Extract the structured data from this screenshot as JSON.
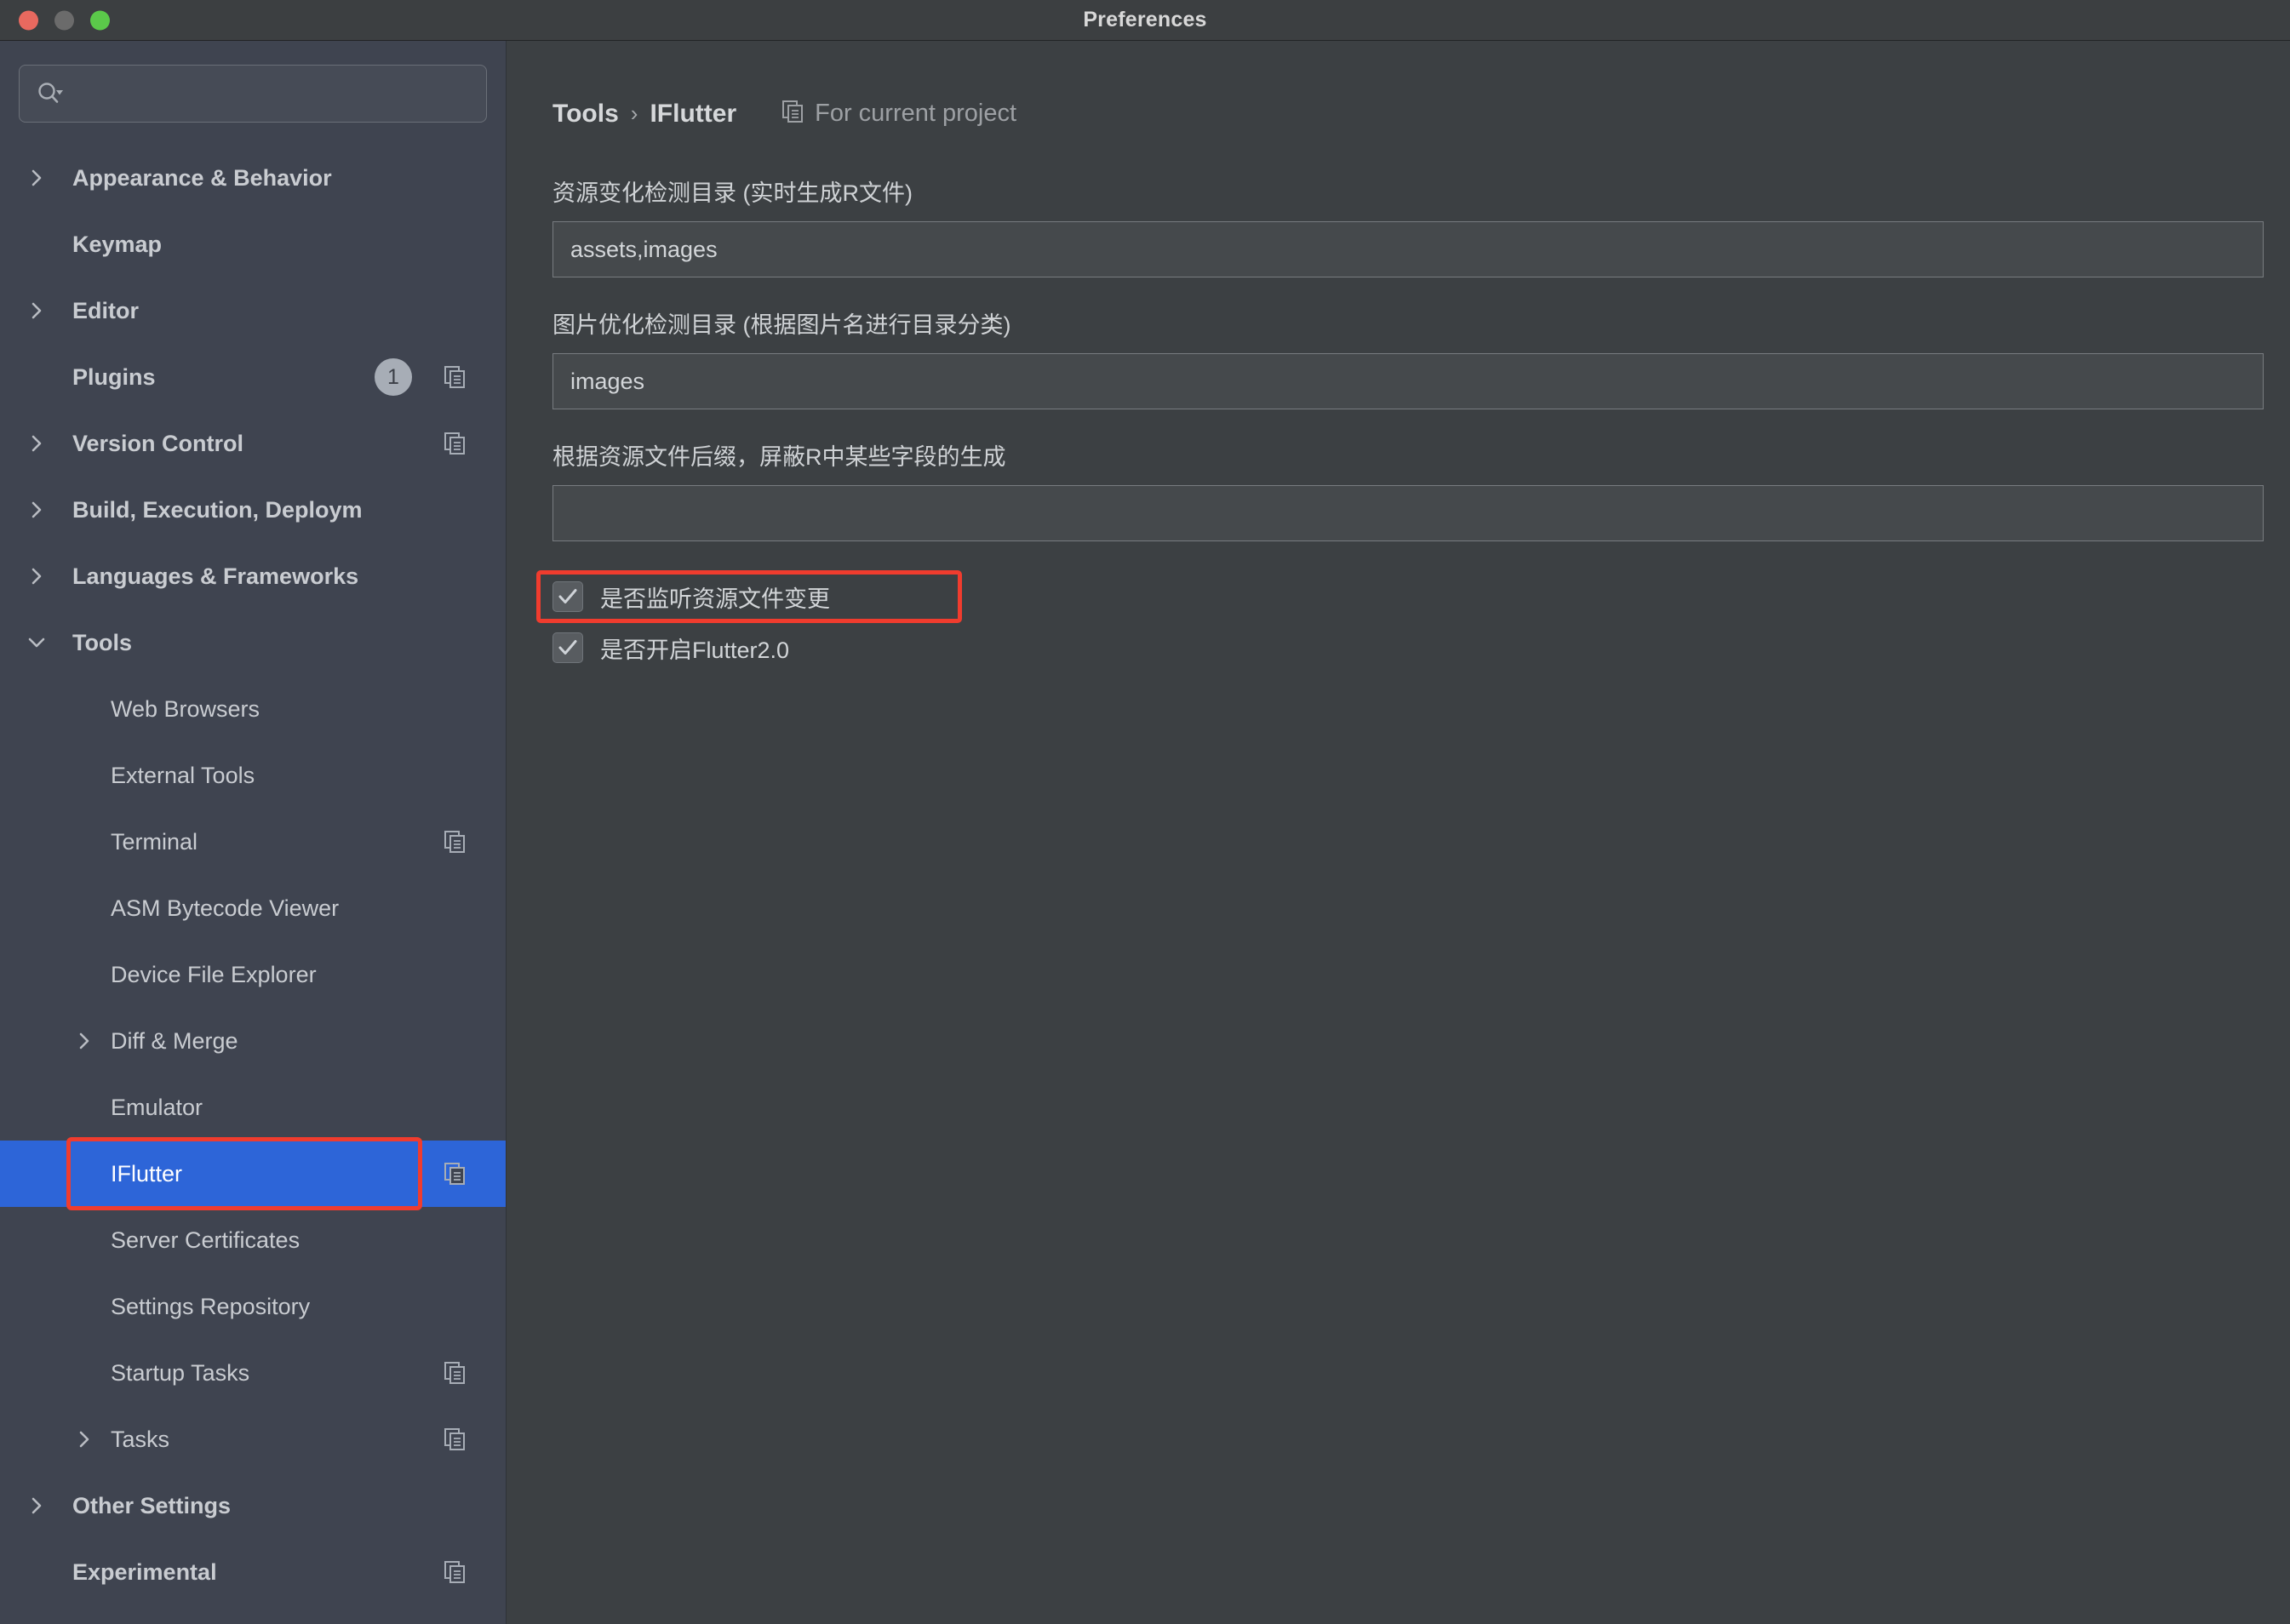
{
  "window": {
    "title": "Preferences",
    "traffic_lights": [
      "close-button",
      "minimize-button",
      "maximize-button"
    ]
  },
  "sidebar": {
    "search": {
      "value": "",
      "placeholder": "",
      "icon": "search-icon"
    },
    "items": [
      {
        "label": "Appearance & Behavior",
        "depth": 0,
        "chevron": "right",
        "bold": true,
        "badge": null,
        "copy_icon": false,
        "selected": false
      },
      {
        "label": "Keymap",
        "depth": 0,
        "chevron": "none",
        "bold": true,
        "badge": null,
        "copy_icon": false,
        "selected": false
      },
      {
        "label": "Editor",
        "depth": 0,
        "chevron": "right",
        "bold": true,
        "badge": null,
        "copy_icon": false,
        "selected": false
      },
      {
        "label": "Plugins",
        "depth": 0,
        "chevron": "none",
        "bold": true,
        "badge": "1",
        "copy_icon": true,
        "selected": false
      },
      {
        "label": "Version Control",
        "depth": 0,
        "chevron": "right",
        "bold": true,
        "badge": null,
        "copy_icon": true,
        "selected": false
      },
      {
        "label": "Build, Execution, Deploym",
        "depth": 0,
        "chevron": "right",
        "bold": true,
        "badge": null,
        "copy_icon": false,
        "selected": false
      },
      {
        "label": "Languages & Frameworks",
        "depth": 0,
        "chevron": "right",
        "bold": true,
        "badge": null,
        "copy_icon": false,
        "selected": false
      },
      {
        "label": "Tools",
        "depth": 0,
        "chevron": "down",
        "bold": true,
        "badge": null,
        "copy_icon": false,
        "selected": false
      },
      {
        "label": "Web Browsers",
        "depth": 1,
        "chevron": "none",
        "bold": false,
        "badge": null,
        "copy_icon": false,
        "selected": false
      },
      {
        "label": "External Tools",
        "depth": 1,
        "chevron": "none",
        "bold": false,
        "badge": null,
        "copy_icon": false,
        "selected": false
      },
      {
        "label": "Terminal",
        "depth": 1,
        "chevron": "none",
        "bold": false,
        "badge": null,
        "copy_icon": true,
        "selected": false
      },
      {
        "label": "ASM Bytecode Viewer",
        "depth": 1,
        "chevron": "none",
        "bold": false,
        "badge": null,
        "copy_icon": false,
        "selected": false
      },
      {
        "label": "Device File Explorer",
        "depth": 1,
        "chevron": "none",
        "bold": false,
        "badge": null,
        "copy_icon": false,
        "selected": false
      },
      {
        "label": "Diff & Merge",
        "depth": 1,
        "chevron": "right",
        "bold": false,
        "badge": null,
        "copy_icon": false,
        "selected": false
      },
      {
        "label": "Emulator",
        "depth": 1,
        "chevron": "none",
        "bold": false,
        "badge": null,
        "copy_icon": false,
        "selected": false
      },
      {
        "label": "IFlutter",
        "depth": 1,
        "chevron": "none",
        "bold": false,
        "badge": null,
        "copy_icon": true,
        "selected": true
      },
      {
        "label": "Server Certificates",
        "depth": 1,
        "chevron": "none",
        "bold": false,
        "badge": null,
        "copy_icon": false,
        "selected": false
      },
      {
        "label": "Settings Repository",
        "depth": 1,
        "chevron": "none",
        "bold": false,
        "badge": null,
        "copy_icon": false,
        "selected": false
      },
      {
        "label": "Startup Tasks",
        "depth": 1,
        "chevron": "none",
        "bold": false,
        "badge": null,
        "copy_icon": true,
        "selected": false
      },
      {
        "label": "Tasks",
        "depth": 1,
        "chevron": "right",
        "bold": false,
        "badge": null,
        "copy_icon": true,
        "selected": false
      },
      {
        "label": "Other Settings",
        "depth": 0,
        "chevron": "right",
        "bold": true,
        "badge": null,
        "copy_icon": false,
        "selected": false
      },
      {
        "label": "Experimental",
        "depth": 0,
        "chevron": "none",
        "bold": true,
        "badge": null,
        "copy_icon": true,
        "selected": false
      }
    ]
  },
  "main": {
    "breadcrumb": {
      "root": "Tools",
      "separator": "›",
      "current": "IFlutter"
    },
    "for_current_project": {
      "label": "For current project",
      "icon": "copy-project-icon"
    },
    "fields": [
      {
        "label": "资源变化检测目录 (实时生成R文件)",
        "value": "assets,images",
        "placeholder": ""
      },
      {
        "label": "图片优化检测目录 (根据图片名进行目录分类)",
        "value": "images",
        "placeholder": ""
      },
      {
        "label": "根据资源文件后缀，屏蔽R中某些字段的生成",
        "value": "",
        "placeholder": ""
      }
    ],
    "checkboxes": [
      {
        "label": "是否监听资源文件变更",
        "checked": true,
        "highlighted": true
      },
      {
        "label": "是否开启Flutter2.0",
        "checked": true,
        "highlighted": false
      }
    ]
  },
  "colors": {
    "titlebar_bg": "#3c3f41",
    "sidebar_bg": "#3f4450",
    "main_bg": "#3c4043",
    "selection_blue": "#2d65d8",
    "annotation_red": "#f03c2e",
    "field_bg": "#45494c",
    "text_primary": "#d3d6d9",
    "text_muted": "#9da0a4"
  }
}
